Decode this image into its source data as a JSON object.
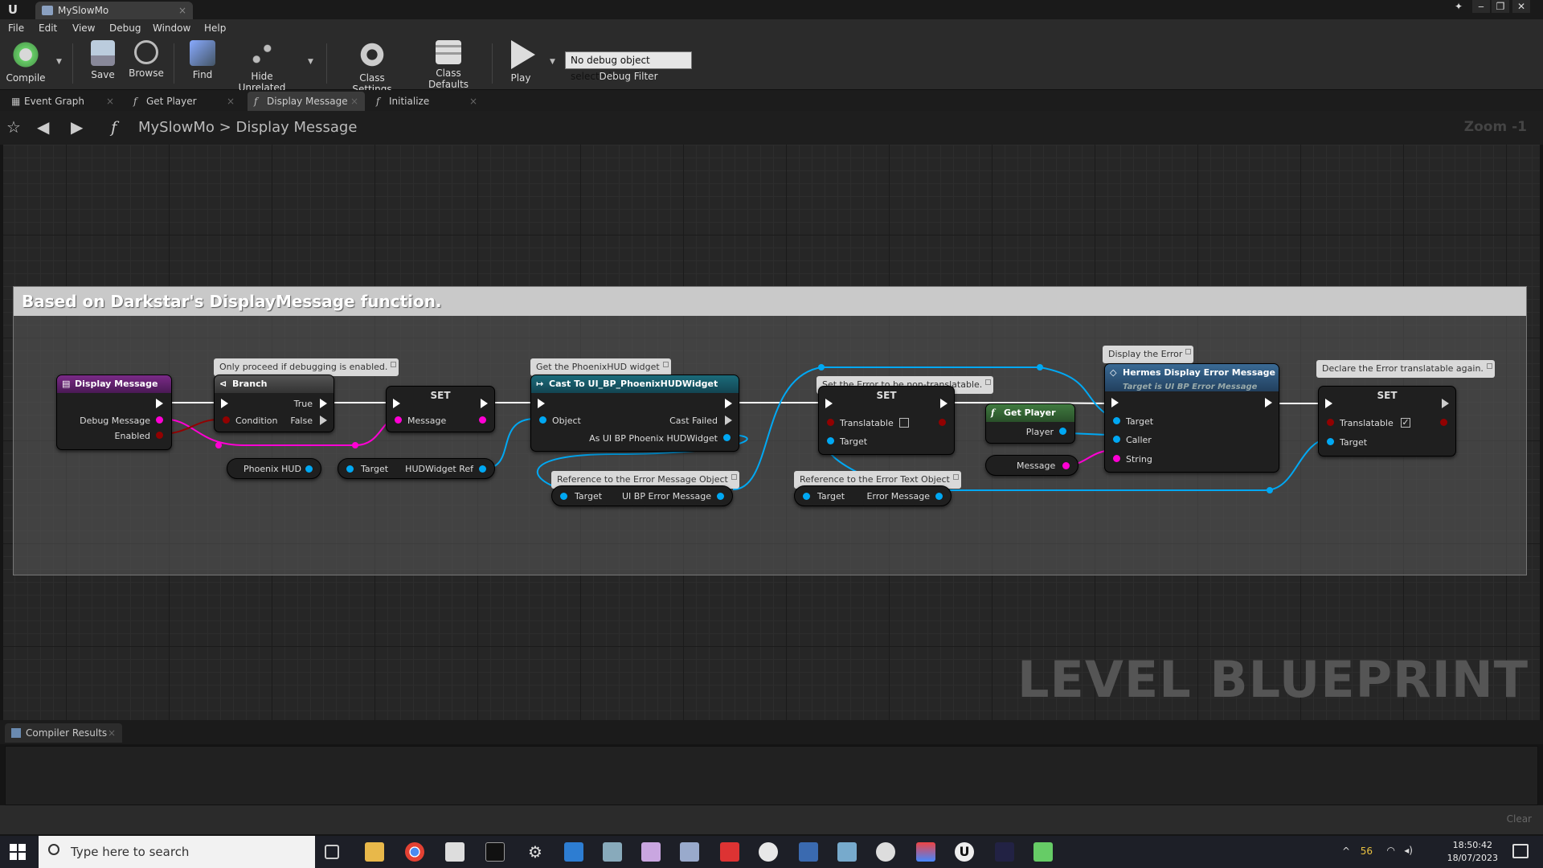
{
  "window": {
    "tab_title": "MySlowMo"
  },
  "menu": [
    "File",
    "Edit",
    "View",
    "Debug",
    "Window",
    "Help"
  ],
  "toolbar": {
    "compile": "Compile",
    "save": "Save",
    "browse": "Browse",
    "find": "Find",
    "hide_unrelated": "Hide Unrelated",
    "class_settings": "Class Settings",
    "class_defaults": "Class Defaults",
    "play": "Play",
    "debug_select": "No debug object selected",
    "debug_filter": "Debug Filter"
  },
  "graph_tabs": [
    "Event Graph",
    "Get Player",
    "Display Message",
    "Initialize"
  ],
  "breadcrumb": {
    "root": "MySlowMo",
    "sep": ">",
    "current": "Display Message"
  },
  "zoom": "Zoom -1",
  "comment": "Based on Darkstar's DisplayMessage function.",
  "bubbles": {
    "debug": "Only proceed if debugging is enabled.",
    "widget": "Get the PhoenixHUD widget",
    "translatable": "Set the Error to be non-translatable.",
    "display": "Display the Error",
    "declare": "Declare the Error translatable again.",
    "error_obj": "Reference to the Error Message Object",
    "error_text": "Reference to the Error Text Object"
  },
  "nodes": {
    "display_message": {
      "title": "Display Message",
      "pins": [
        "Debug Message",
        "Enabled"
      ]
    },
    "branch": {
      "title": "Branch",
      "condition": "Condition",
      "true": "True",
      "false": "False"
    },
    "set1": {
      "title": "SET",
      "pin": "Message"
    },
    "cast": {
      "title": "Cast To UI_BP_PhoenixHUDWidget",
      "object": "Object",
      "cast_failed": "Cast Failed",
      "as": "As UI BP Phoenix HUDWidget"
    },
    "set2": {
      "title": "SET",
      "translatable": "Translatable",
      "target": "Target"
    },
    "get_player": {
      "title": "Get Player",
      "player": "Player"
    },
    "hermes": {
      "title": "Hermes Display Error Message",
      "subtitle": "Target is UI BP Error Message",
      "pins": [
        "Target",
        "Caller",
        "String"
      ]
    },
    "set3": {
      "title": "SET",
      "translatable": "Translatable",
      "target": "Target"
    },
    "phoenix_hud": "Phoenix HUD",
    "hud_ref": {
      "in": "Target",
      "out": "HUDWidget Ref"
    },
    "err_msg": {
      "in": "Target",
      "out": "UI BP Error Message"
    },
    "err_text": {
      "in": "Target",
      "out": "Error Message"
    },
    "message": "Message"
  },
  "watermark": "LEVEL BLUEPRINT",
  "compiler": {
    "tab": "Compiler Results",
    "clear": "Clear"
  },
  "taskbar": {
    "search_placeholder": "Type here to search",
    "temp": "56",
    "time": "18:50:42",
    "date": "18/07/2023"
  },
  "colors": {
    "exec": "#ffffff",
    "object_pin": "#00a8f3",
    "string_pin": "#ff00d4",
    "bool_pin": "#920101",
    "function_head": "#7a2a87",
    "cast_head": "#1b5c6b",
    "set_head": "#2a2a2a",
    "hermes_head": "#2a4a6a",
    "getplayer_head": "#2f5a2f"
  }
}
